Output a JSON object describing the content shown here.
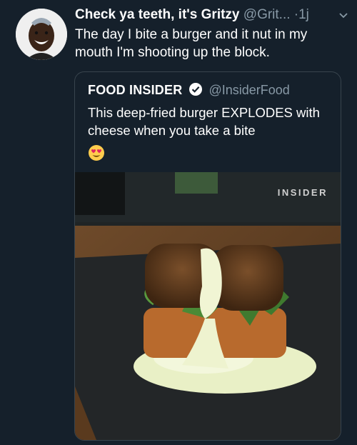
{
  "tweet": {
    "display_name": "Check ya teeth, it's Gritzy",
    "handle_time": "@Grit... ·1j",
    "text": "The day I bite a burger and it nut in my mouth I'm shooting up the block.",
    "icons": {
      "avatar": "avatar-photo",
      "more": "chevron-down-icon"
    }
  },
  "quoted_tweet": {
    "display_name": "FOOD INSIDER",
    "handle": "@InsiderFood",
    "text": "This deep-fried burger EXPLODES with cheese when you take a bite",
    "icons": {
      "verified": "verified-badge-icon",
      "emoji": "heart-eyes-emoji"
    },
    "media": {
      "watermark": "INSIDER",
      "description_icon": "burger-photo"
    }
  },
  "colors": {
    "background": "#15202b",
    "muted": "#8899a6",
    "border": "#38444d",
    "text": "#ffffff"
  }
}
